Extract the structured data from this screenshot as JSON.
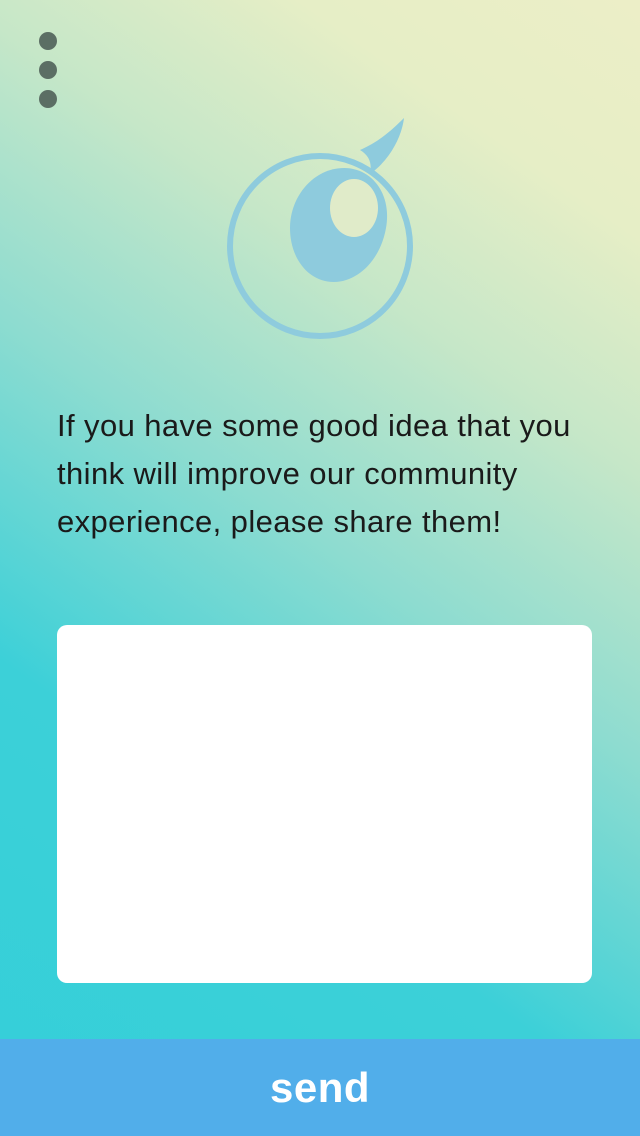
{
  "header": {
    "menu_icon": "vertical-ellipsis-icon"
  },
  "logo": {
    "icon": "eye-speech-bubble-logo",
    "color": "#8ecbdd"
  },
  "prompt": {
    "text": "If you have some good idea that you think will improve our community experience, please share them!"
  },
  "idea_input": {
    "value": "",
    "placeholder": ""
  },
  "send_button": {
    "label": "send",
    "color": "#51aeea"
  },
  "colors": {
    "gradient_start": "#34cfd9",
    "gradient_end": "#eceec7",
    "menu_dots": "#5b6e64",
    "text": "#1a1a1a"
  }
}
